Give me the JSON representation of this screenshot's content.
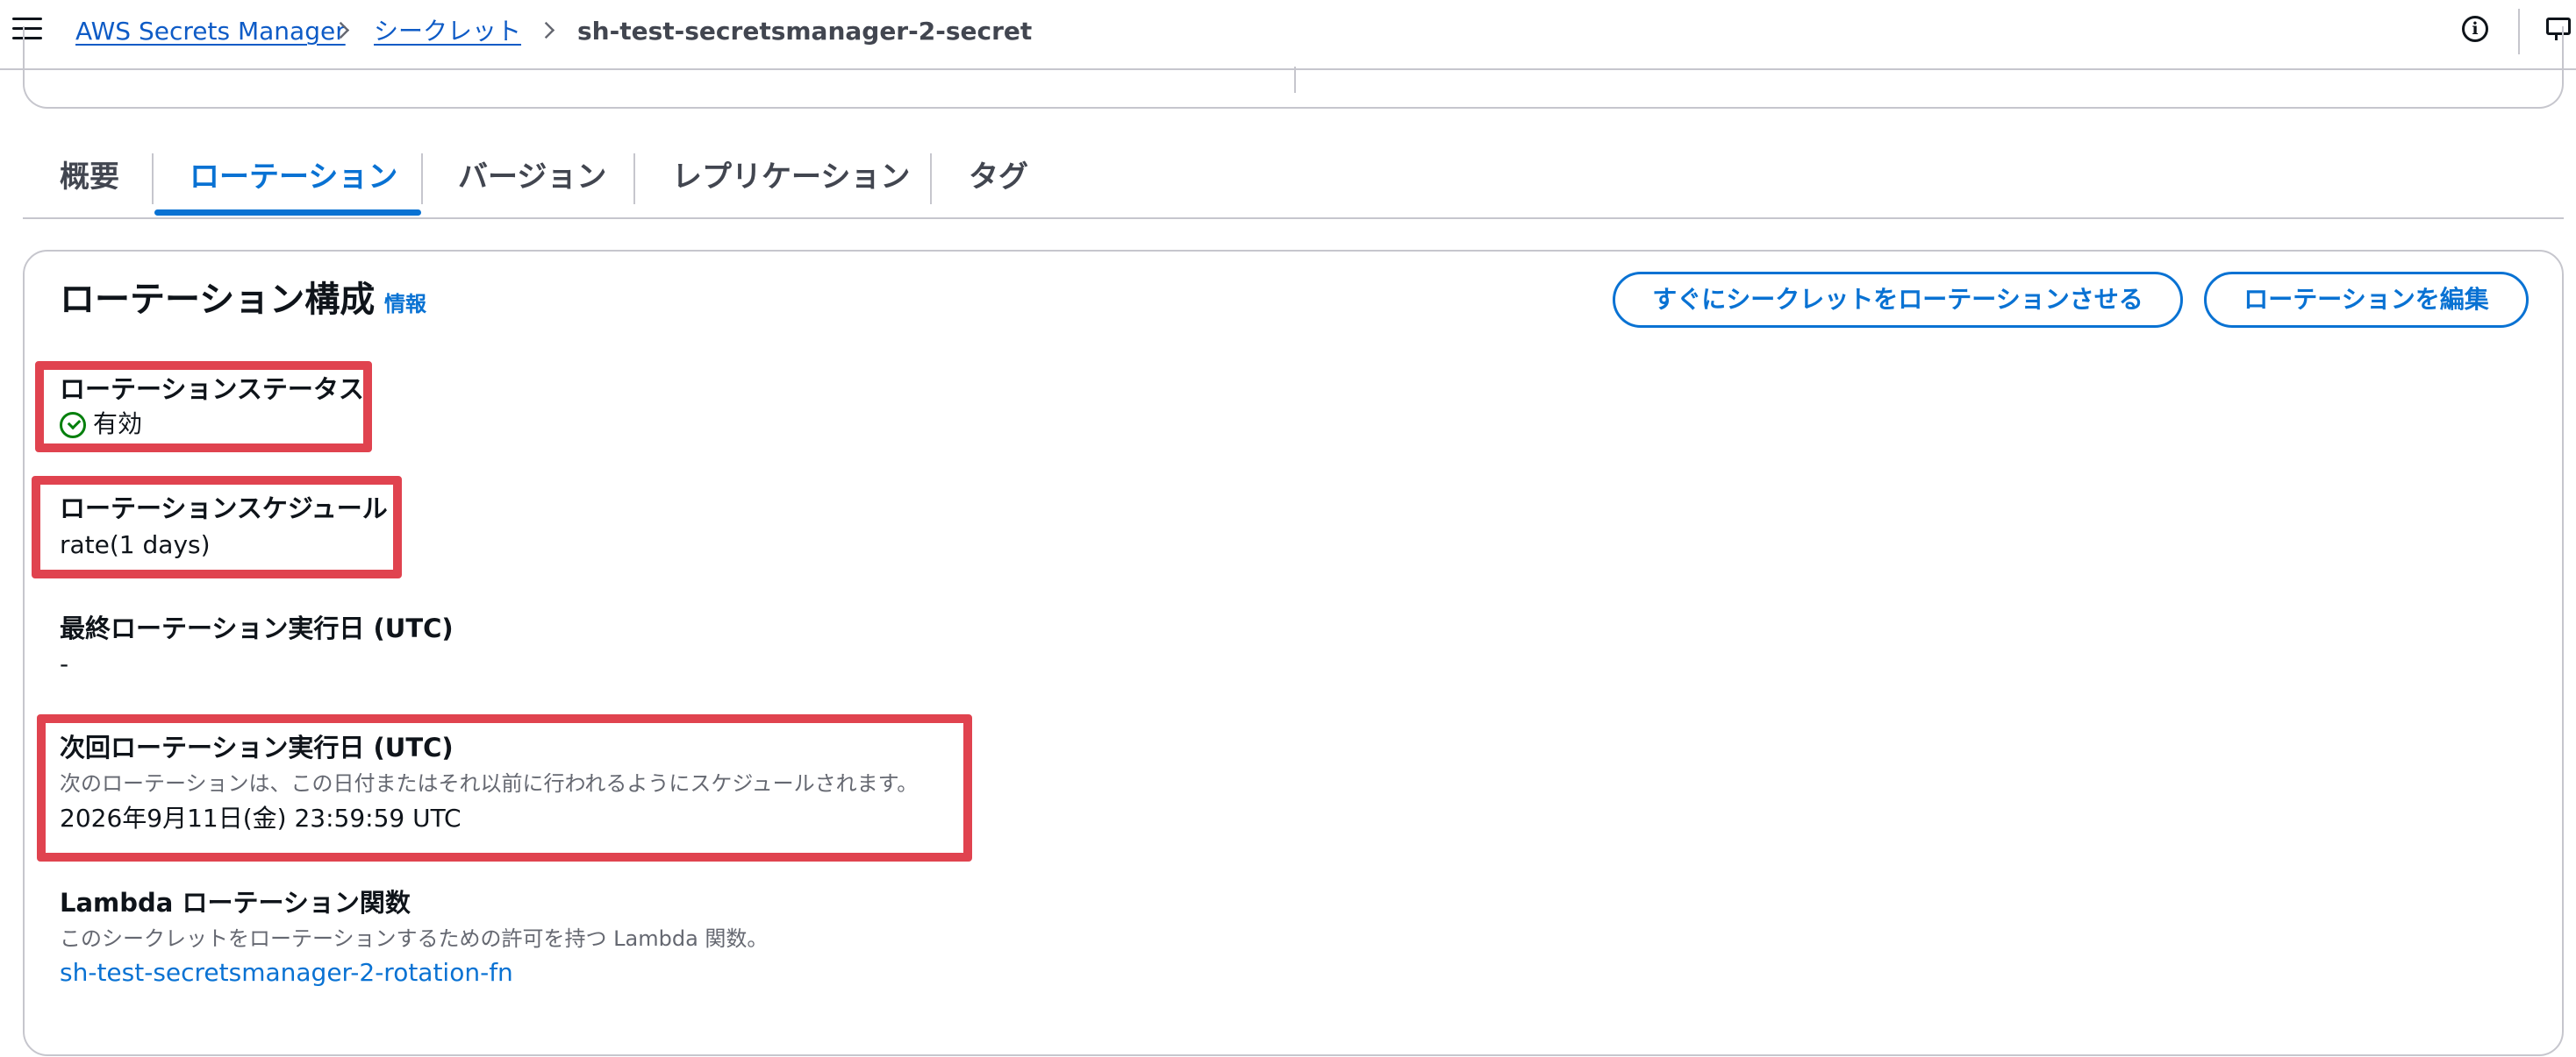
{
  "breadcrumb": {
    "items": [
      {
        "label": "AWS Secrets Manager"
      },
      {
        "label": "シークレット"
      },
      {
        "label": "sh-test-secretsmanager-2-secret"
      }
    ]
  },
  "tabs": [
    {
      "label": "概要",
      "active": false
    },
    {
      "label": "ローテーション",
      "active": true
    },
    {
      "label": "バージョン",
      "active": false
    },
    {
      "label": "レプリケーション",
      "active": false
    },
    {
      "label": "タグ",
      "active": false
    }
  ],
  "rotation": {
    "title": "ローテーション構成",
    "info_link": "情報",
    "rotate_now_button": "すぐにシークレットをローテーションさせる",
    "edit_button": "ローテーションを編集",
    "status": {
      "label": "ローテーションステータス",
      "value": "有効"
    },
    "schedule": {
      "label": "ローテーションスケジュール",
      "value": "rate(1 days)"
    },
    "last_rotated": {
      "label": "最終ローテーション実行日 (UTC)",
      "value": "-"
    },
    "next_rotation": {
      "label": "次回ローテーション実行日 (UTC)",
      "description": "次のローテーションは、この日付またはそれ以前に行われるようにスケジュールされます。",
      "value": "2026年9月11日(金) 23:59:59 UTC"
    },
    "lambda": {
      "label": "Lambda ローテーション関数",
      "description": "このシークレットをローテーションするための許可を持つ Lambda 関数。",
      "value": "sh-test-secretsmanager-2-rotation-fn"
    }
  },
  "colors": {
    "accent": "#0972d3",
    "success": "#037f0c",
    "highlight": "#e0434f",
    "border": "#c6c6cd"
  }
}
